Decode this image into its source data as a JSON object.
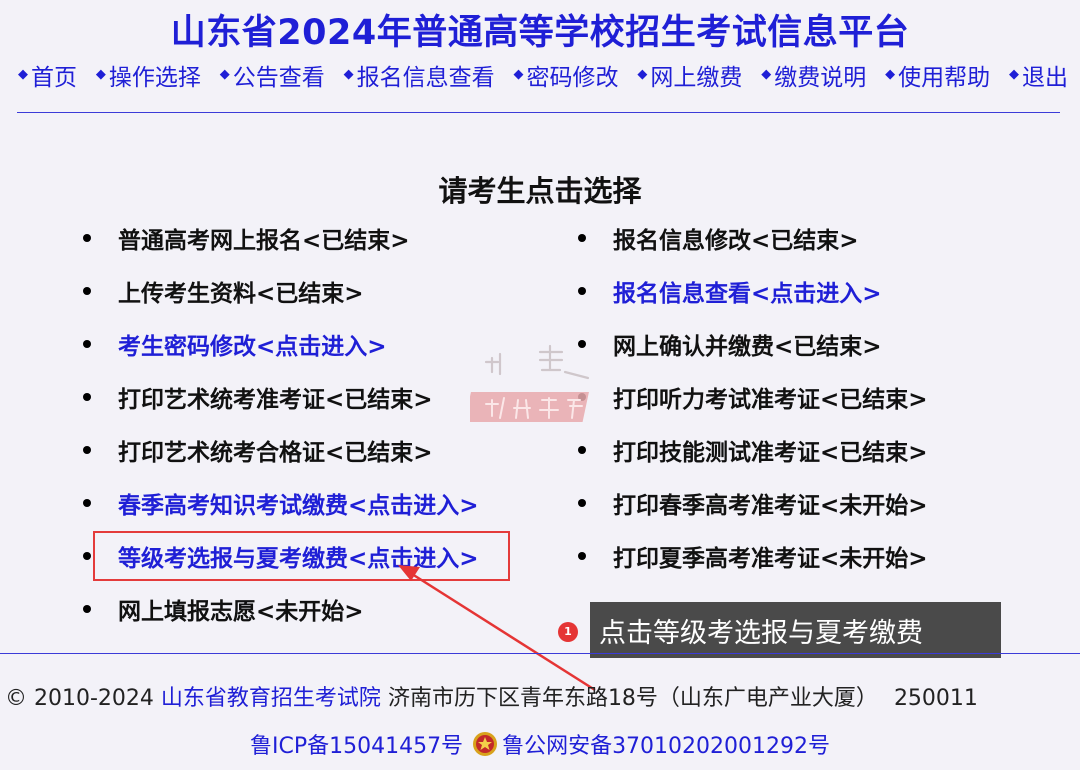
{
  "header": {
    "title": "山东省2024年普通高等学校招生考试信息平台",
    "nav": [
      "首页",
      "操作选择",
      "公告查看",
      "报名信息查看",
      "密码修改",
      "网上缴费",
      "缴费说明",
      "使用帮助",
      "退出"
    ]
  },
  "main": {
    "heading": "请考生点击选择",
    "left_options": [
      {
        "label": "普通高考网上报名<已结束>"
      },
      {
        "label": "上传考生资料<已结束>"
      },
      {
        "label": "考生密码修改<点击进入>"
      },
      {
        "label": "打印艺术统考准考证<已结束>"
      },
      {
        "label": "打印艺术统考合格证<已结束>"
      },
      {
        "label": "春季高考知识考试缴费<点击进入>"
      },
      {
        "label": "等级考选报与夏考缴费<点击进入>"
      },
      {
        "label": "网上填报志愿<未开始>"
      }
    ],
    "right_options": [
      {
        "label": "报名信息修改<已结束>"
      },
      {
        "label": "报名信息查看<点击进入>"
      },
      {
        "label": "网上确认并缴费<已结束>"
      },
      {
        "label": "打印听力考试准考证<已结束>"
      },
      {
        "label": "打印技能测试准考证<已结束>"
      },
      {
        "label": "打印春季高考准考证<未开始>"
      },
      {
        "label": "打印夏季高考准考证<未开始>"
      }
    ]
  },
  "annotation": {
    "step_number": "1",
    "text": "点击等级考选报与夏考缴费",
    "color": "#e53535"
  },
  "footer": {
    "copyright": "© 2010-2024",
    "org": "山东省教育招生考试院",
    "address": "济南市历下区青年东路18号（山东广电产业大厦）",
    "postcode": "250011",
    "icp": "鲁ICP备15041457号",
    "police_record": "鲁公网安备37010202001292号"
  },
  "colors": {
    "link": "#1f1fd6",
    "text": "#111111",
    "background": "#f3f2f8",
    "highlight": "#e43b3b"
  },
  "icons": [
    "diamond-bullet-icon",
    "police-badge-icon",
    "arrow-annotation",
    "watermark-seal"
  ]
}
